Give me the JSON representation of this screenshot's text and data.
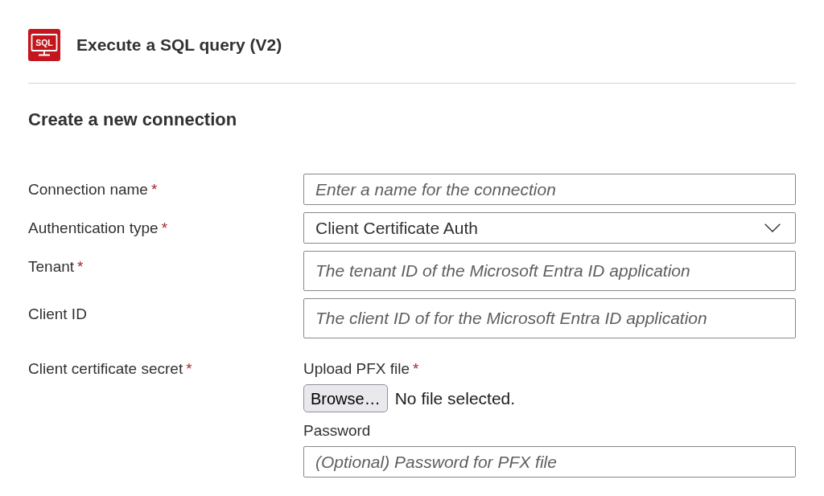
{
  "header": {
    "icon_text": "SQL",
    "title": "Execute a SQL query (V2)"
  },
  "section_title": "Create a new connection",
  "fields": [
    {
      "kind": "text",
      "label": "Connection name",
      "required_mark": "*",
      "placeholder": "Enter a name for the connection"
    },
    {
      "kind": "select",
      "label": "Authentication type",
      "required_mark": "*",
      "value": "Client Certificate Auth"
    },
    {
      "kind": "textarea",
      "label": "Tenant",
      "required_mark": "*",
      "placeholder": "The tenant ID of the Microsoft Entra ID application"
    },
    {
      "kind": "textarea",
      "label": "Client ID",
      "placeholder": "The client ID of for the Microsoft Entra ID application"
    },
    {
      "kind": "group",
      "label": "Client certificate secret",
      "required_mark": "*",
      "children": [
        {
          "kind": "file",
          "label": "Upload PFX file",
          "required_mark": "*",
          "button": "Browse…",
          "status": "No file selected."
        },
        {
          "kind": "text",
          "label": "Password",
          "placeholder": "(Optional) Password for PFX file"
        }
      ]
    }
  ]
}
